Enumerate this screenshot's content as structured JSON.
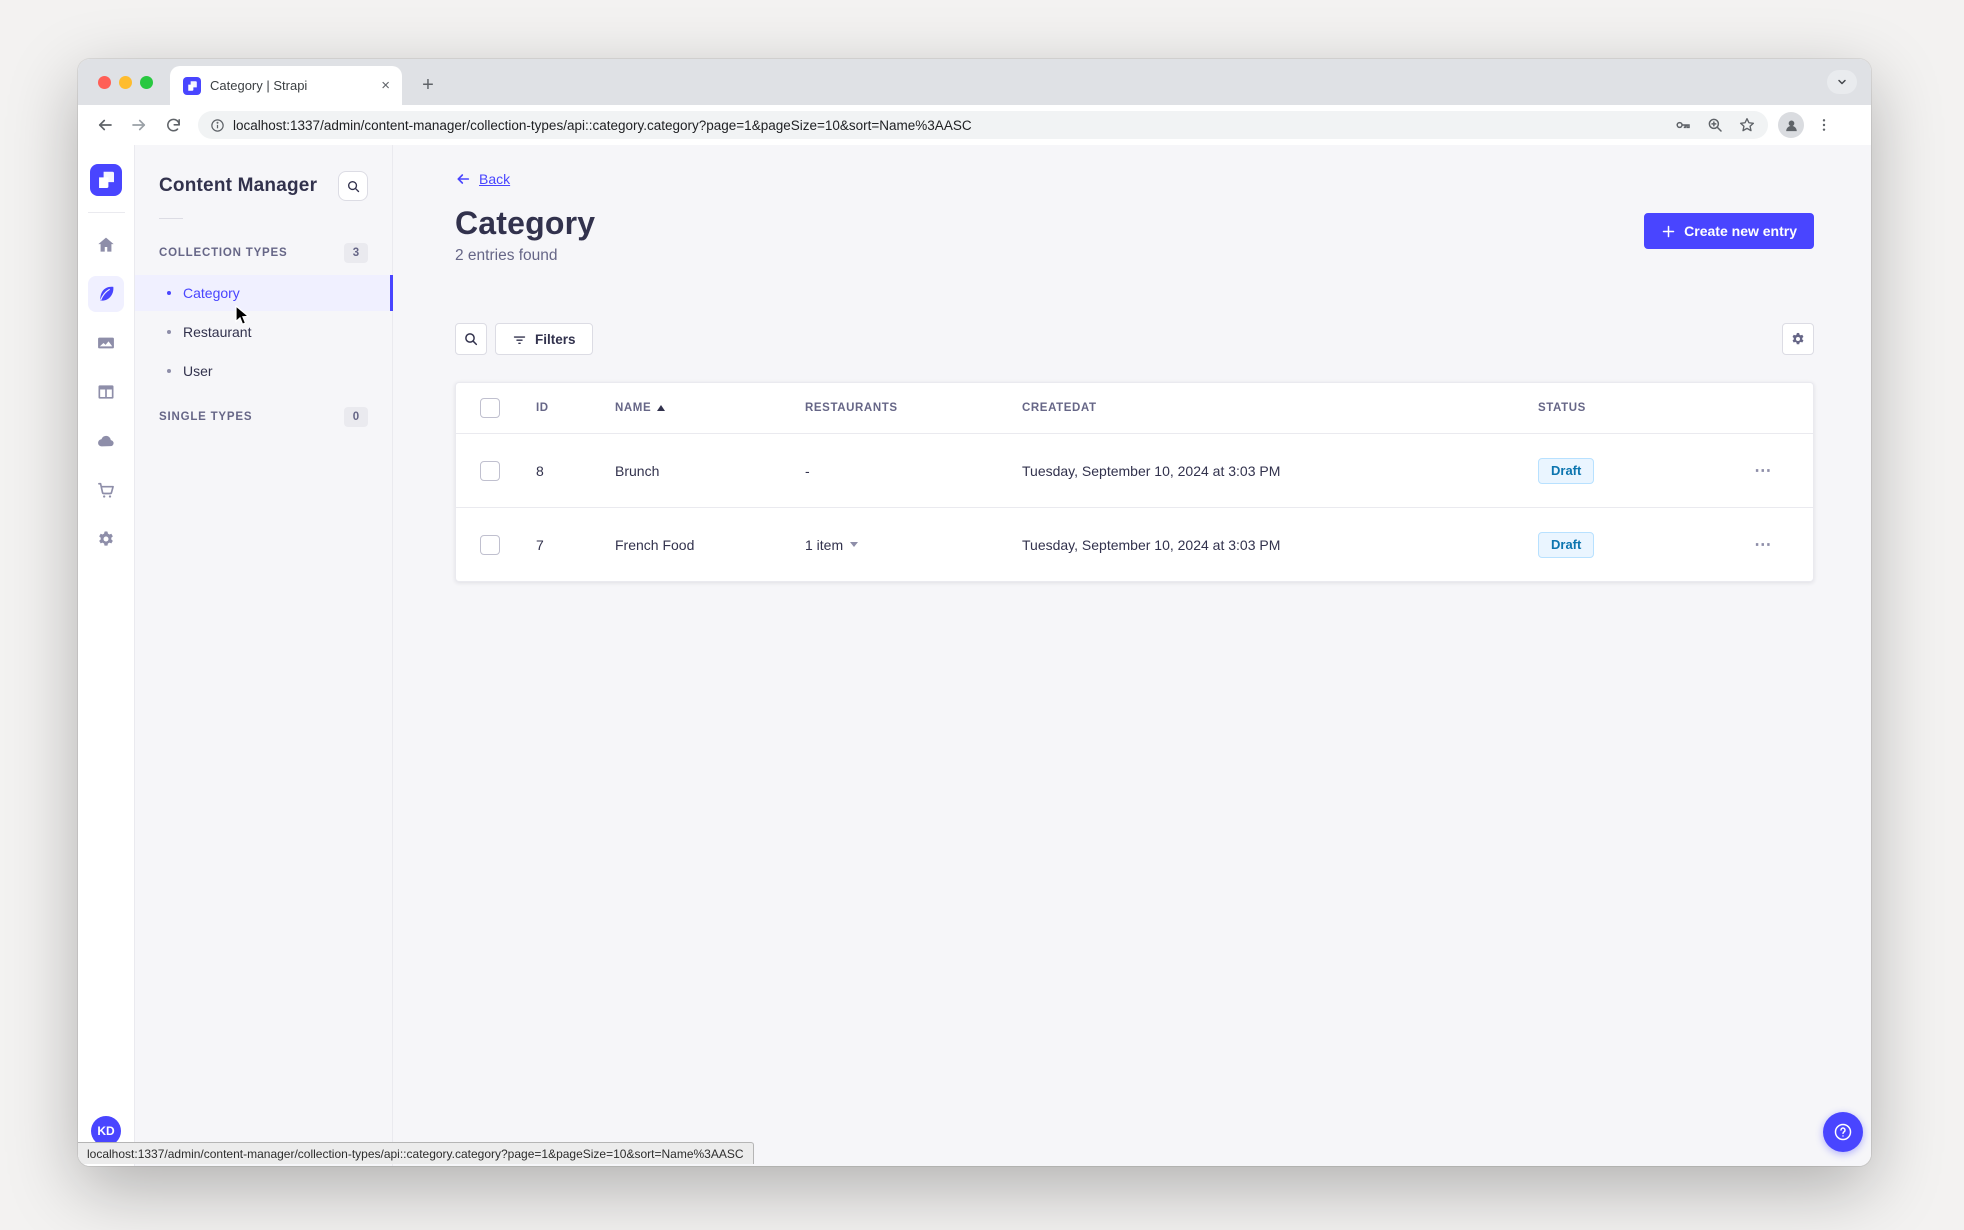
{
  "colors": {
    "primary": "#4945ff",
    "primary_light": "#f0f0ff",
    "draft_bg": "#eaf5ff",
    "draft_border": "#b8e1ff",
    "draft_text": "#0c75af",
    "neutral_text": "#32324d",
    "muted_text": "#666687"
  },
  "browser": {
    "tab_title": "Category | Strapi",
    "tab_close": "×",
    "new_tab": "+",
    "url": "localhost:1337/admin/content-manager/collection-types/api::category.category?page=1&pageSize=10&sort=Name%3AASC",
    "status_bar_url": "localhost:1337/admin/content-manager/collection-types/api::category.category?page=1&pageSize=10&sort=Name%3AASC"
  },
  "nav": {
    "items": [
      {
        "name": "home"
      },
      {
        "name": "content-manager",
        "active": true
      },
      {
        "name": "media-library"
      },
      {
        "name": "content-type-builder"
      },
      {
        "name": "cloud"
      },
      {
        "name": "marketplace"
      },
      {
        "name": "settings"
      }
    ],
    "avatar_initials": "KD"
  },
  "subnav": {
    "title": "Content Manager",
    "collection_types": {
      "label": "COLLECTION TYPES",
      "badge": "3",
      "items": [
        {
          "label": "Category",
          "active": true
        },
        {
          "label": "Restaurant"
        },
        {
          "label": "User"
        }
      ]
    },
    "single_types": {
      "label": "SINGLE TYPES",
      "badge": "0"
    }
  },
  "header": {
    "back_label": "Back",
    "title": "Category",
    "subtitle": "2 entries found",
    "create_button": "Create new entry"
  },
  "toolbar": {
    "filters_label": "Filters"
  },
  "table": {
    "headers": {
      "id": "ID",
      "name": "NAME",
      "restaurants": "RESTAURANTS",
      "createdat": "CREATEDAT",
      "status": "STATUS"
    },
    "sorted_by": "NAME",
    "sort_direction": "ascending",
    "rows": [
      {
        "id": "8",
        "name": "Brunch",
        "restaurants": "-",
        "restaurants_expandable": false,
        "createdat": "Tuesday, September 10, 2024 at 3:03 PM",
        "status": "Draft"
      },
      {
        "id": "7",
        "name": "French Food",
        "restaurants": "1 item",
        "restaurants_expandable": true,
        "createdat": "Tuesday, September 10, 2024 at 3:03 PM",
        "status": "Draft"
      }
    ]
  }
}
